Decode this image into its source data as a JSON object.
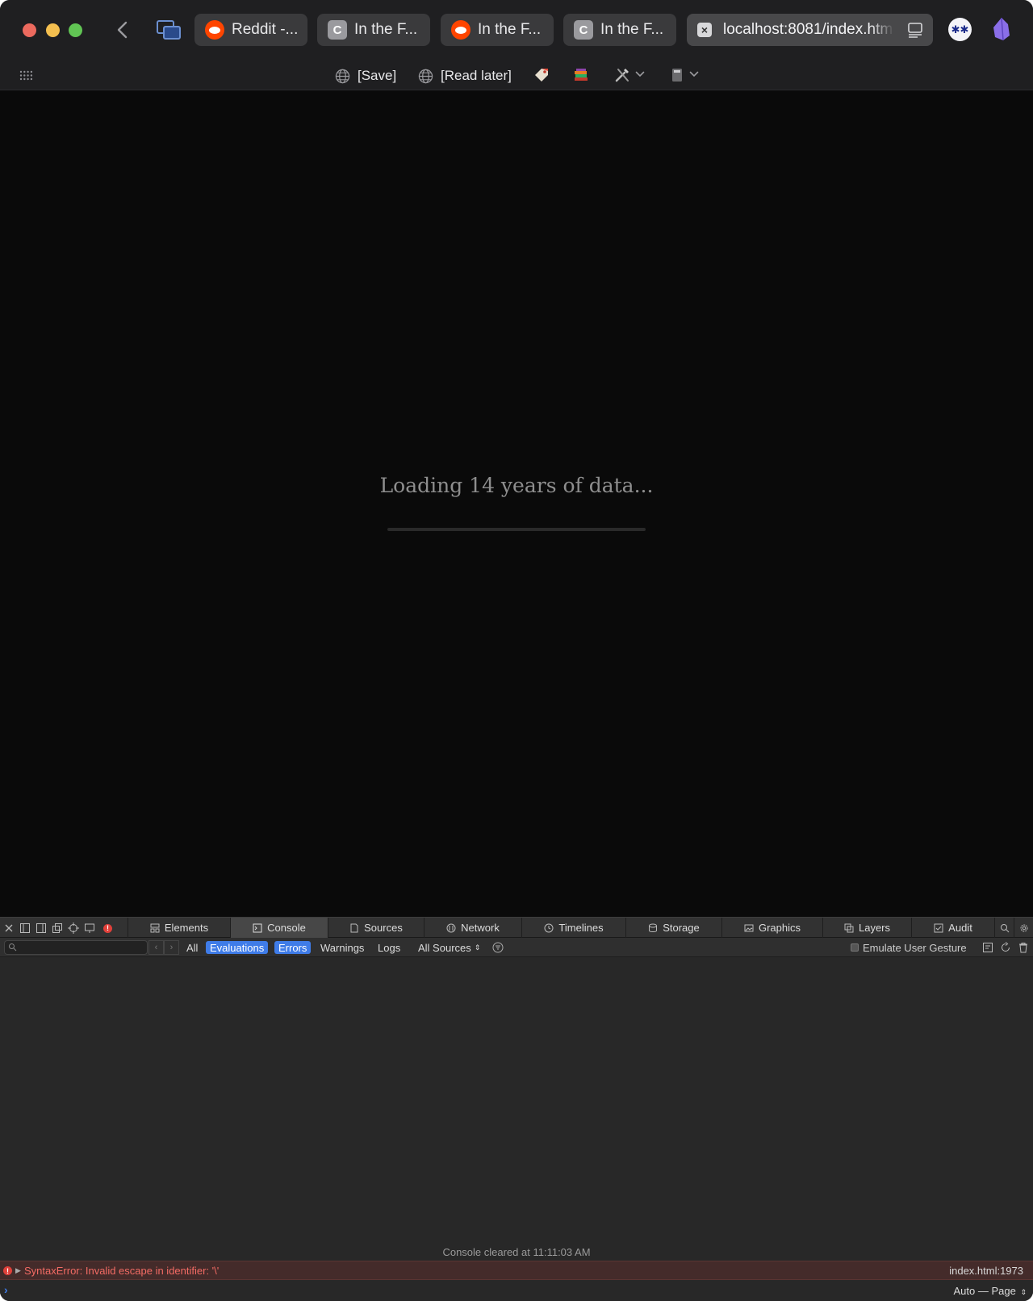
{
  "browser": {
    "tabs": [
      {
        "label": "Reddit -...",
        "icon": "reddit-icon"
      },
      {
        "label": "In the F...",
        "icon": "c-letter-icon",
        "letter": "C"
      },
      {
        "label": "In the F...",
        "icon": "reddit-icon"
      },
      {
        "label": "In the F...",
        "icon": "c-letter-icon",
        "letter": "C"
      }
    ],
    "url": "localhost:8081/index.htm",
    "extension_1_glyph": "✱✱"
  },
  "favorites": {
    "save_label": "[Save]",
    "read_later_label": "[Read later]"
  },
  "page": {
    "loading_text": "Loading 14 years of data...",
    "progress": 0
  },
  "inspector": {
    "tabs": [
      "Elements",
      "Console",
      "Sources",
      "Network",
      "Timelines",
      "Storage",
      "Graphics",
      "Layers",
      "Audit"
    ],
    "active_tab": "Console",
    "filters": {
      "all": "All",
      "evaluations": "Evaluations",
      "errors": "Errors",
      "warnings": "Warnings",
      "logs": "Logs",
      "sources": "All Sources"
    },
    "emulate_label": "Emulate User Gesture",
    "cleared_message": "Console cleared at 11:11:03 AM",
    "error": {
      "message": "SyntaxError: Invalid escape in identifier: '\\'",
      "location": "index.html:1973"
    },
    "context": "Auto — Page"
  },
  "colors": {
    "accent": "#3f7ce8",
    "error": "#f36b64",
    "reddit": "#ff4500"
  }
}
